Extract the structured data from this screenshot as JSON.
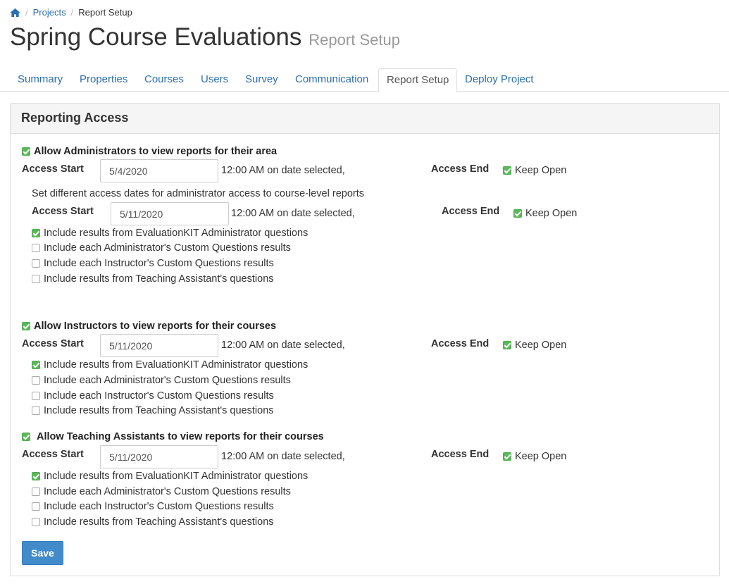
{
  "breadcrumb": {
    "home_icon": "home-icon",
    "items": [
      "Projects",
      "Report Setup"
    ]
  },
  "header": {
    "title": "Spring Course Evaluations",
    "subtitle": "Report Setup"
  },
  "tabs": [
    "Summary",
    "Properties",
    "Courses",
    "Users",
    "Survey",
    "Communication",
    "Report Setup",
    "Deploy Project"
  ],
  "active_tab": "Report Setup",
  "panel": {
    "title": "Reporting Access"
  },
  "labels": {
    "access_start": "Access Start",
    "access_end": "Access End",
    "time_note": "12:00 AM on date selected,",
    "keep_open": "Keep Open"
  },
  "options": [
    "Include results from EvaluationKIT Administrator questions",
    "Include each Administrator's Custom Questions results",
    "Include each Instructor's Custom Questions results",
    "Include results from Teaching Assistant's questions"
  ],
  "administrators": {
    "label": "Allow Administrators to view reports for their area",
    "checked": true,
    "access_start": "5/4/2020",
    "keep_open": true,
    "course_level_note": "Set different access dates for administrator access to course-level reports",
    "course_level_access_start": "5/11/2020",
    "course_level_keep_open": true,
    "options_checked": [
      true,
      false,
      false,
      false
    ]
  },
  "instructors": {
    "label": "Allow Instructors to view reports for their courses",
    "checked": true,
    "access_start": "5/11/2020",
    "keep_open": true,
    "options_checked": [
      true,
      false,
      false,
      false
    ]
  },
  "teaching_assistants": {
    "label": "Allow Teaching Assistants to view reports for their courses",
    "checked": true,
    "access_start": "5/11/2020",
    "keep_open": true,
    "options_checked": [
      true,
      false,
      false,
      false
    ]
  },
  "save_label": "Save",
  "colors": {
    "link": "#2a6fb0",
    "checkbox_checked": "#5cb85c",
    "primary_button": "#428bca"
  }
}
